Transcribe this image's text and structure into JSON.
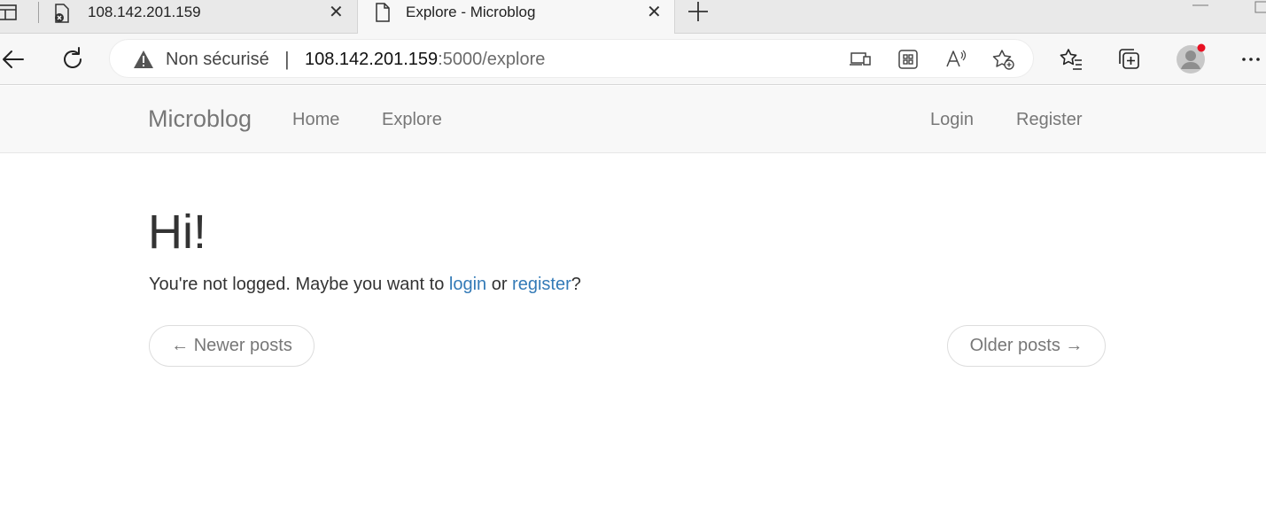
{
  "browser": {
    "tabs": [
      {
        "title": "108.142.201.159",
        "icon": "file-error-icon",
        "close": "✕"
      },
      {
        "title": "Explore - Microblog",
        "icon": "page-icon",
        "close": "✕"
      }
    ],
    "address": {
      "security_label": "Non sécurisé",
      "separator": "|",
      "host": "108.142.201.159",
      "path": ":5000/explore"
    }
  },
  "navbar": {
    "brand": "Microblog",
    "left_links": [
      "Home",
      "Explore"
    ],
    "right_links": [
      "Login",
      "Register"
    ]
  },
  "main": {
    "heading": "Hi!",
    "intro_prefix": "You're not logged. Maybe you want to ",
    "login_link": "login",
    "intro_middle": " or ",
    "register_link": "register",
    "intro_suffix": "?",
    "pager": {
      "newer": "← Newer posts",
      "older": "Older posts →"
    }
  },
  "colors": {
    "link": "#337ab7",
    "navbar_bg": "#f8f8f8",
    "profile_badge": "#e81123"
  }
}
